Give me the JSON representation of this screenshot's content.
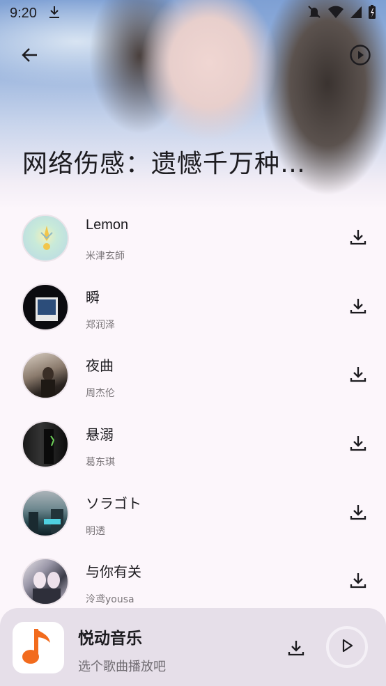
{
  "status_bar": {
    "time": "9:20",
    "icons": [
      "download-icon",
      "notifications-off-icon",
      "wifi-icon",
      "signal-icon",
      "battery-charging-icon"
    ]
  },
  "header": {
    "back_icon": "arrow-left-icon",
    "play_icon": "play-circle-icon",
    "title": "网络伤感：遗憾千万种…"
  },
  "songs": [
    {
      "title": "Lemon",
      "artist": "米津玄師",
      "action_icon": "download-icon"
    },
    {
      "title": "瞬",
      "artist": "郑润泽",
      "action_icon": "download-icon"
    },
    {
      "title": "夜曲",
      "artist": "周杰伦",
      "action_icon": "download-icon"
    },
    {
      "title": "悬溺",
      "artist": "葛东琪",
      "action_icon": "download-icon"
    },
    {
      "title": "ソラゴト",
      "artist": "明透",
      "action_icon": "download-icon"
    },
    {
      "title": "与你有关",
      "artist": "泠鸢yousa",
      "action_icon": "download-icon"
    }
  ],
  "player": {
    "app_name": "悦动音乐",
    "subtitle": "选个歌曲播放吧",
    "app_icon": "music-note-icon",
    "download_icon": "download-icon",
    "play_icon": "play-icon",
    "accent_color": "#f26b1d"
  }
}
